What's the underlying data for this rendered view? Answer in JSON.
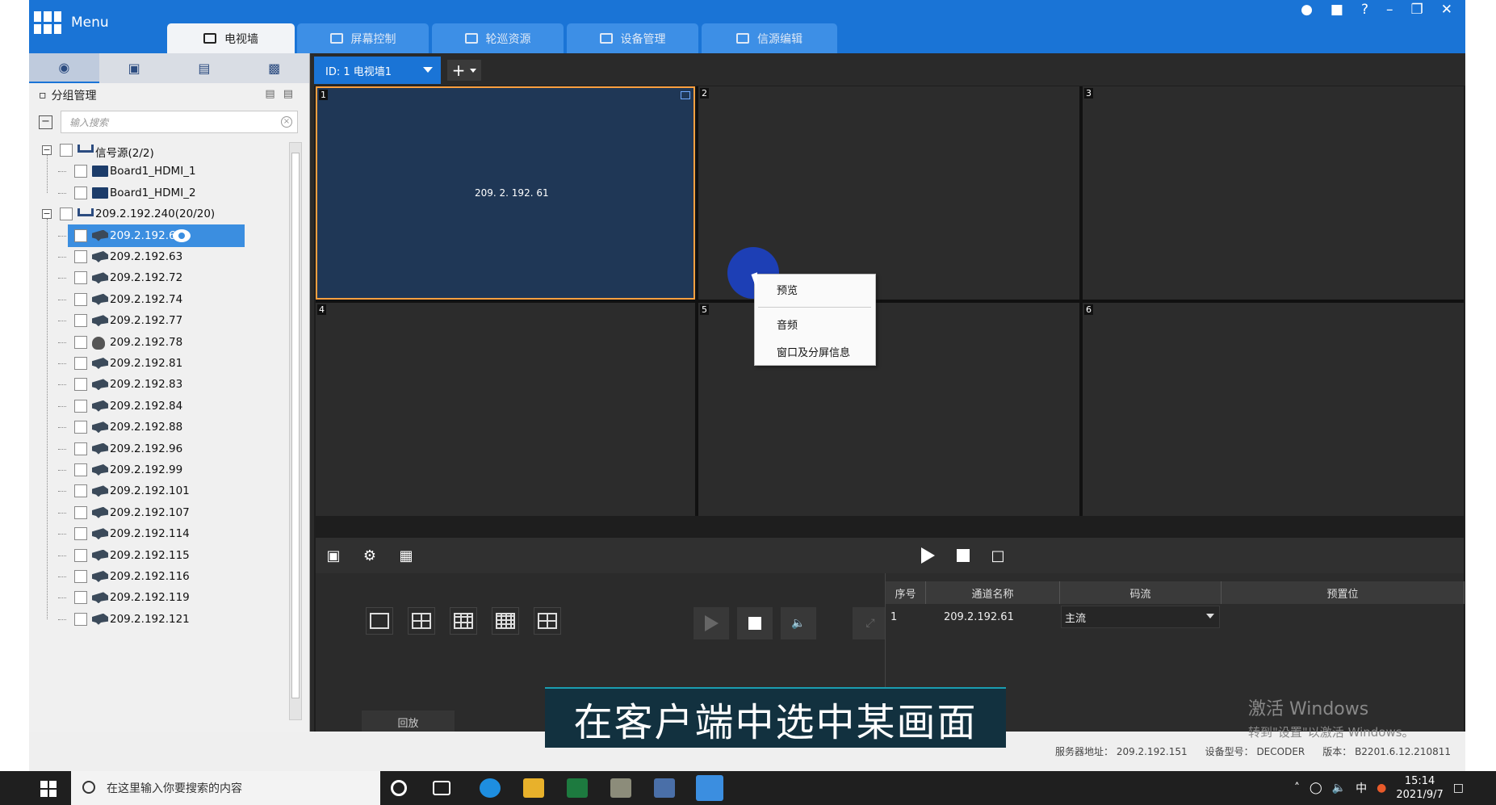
{
  "app": {
    "menu_label": "Menu",
    "tabs": [
      {
        "label": "电视墙",
        "active": true
      },
      {
        "label": "屏幕控制",
        "active": false
      },
      {
        "label": "轮巡资源",
        "active": false
      },
      {
        "label": "设备管理",
        "active": false
      },
      {
        "label": "信源编辑",
        "active": false
      }
    ],
    "window_controls": [
      "user-icon",
      "lock-icon",
      "help-icon",
      "minimize-icon",
      "restore-icon",
      "close-icon"
    ]
  },
  "left_panel": {
    "group_title": "分组管理",
    "search_placeholder": "输入搜索",
    "tree": [
      {
        "label": "信号源(2/2)",
        "type": "group",
        "level": 0
      },
      {
        "label": "Board1_HDMI_1",
        "type": "hdmi",
        "level": 1
      },
      {
        "label": "Board1_HDMI_2",
        "type": "hdmi",
        "level": 1
      },
      {
        "label": "209.2.192.240(20/20)",
        "type": "group",
        "level": 0
      },
      {
        "label": "209.2.192.61",
        "type": "cam",
        "level": 1,
        "selected": true
      },
      {
        "label": "209.2.192.63",
        "type": "cam",
        "level": 1
      },
      {
        "label": "209.2.192.72",
        "type": "cam",
        "level": 1
      },
      {
        "label": "209.2.192.74",
        "type": "cam",
        "level": 1
      },
      {
        "label": "209.2.192.77",
        "type": "cam",
        "level": 1
      },
      {
        "label": "209.2.192.78",
        "type": "dome",
        "level": 1
      },
      {
        "label": "209.2.192.81",
        "type": "cam",
        "level": 1
      },
      {
        "label": "209.2.192.83",
        "type": "cam",
        "level": 1
      },
      {
        "label": "209.2.192.84",
        "type": "cam",
        "level": 1
      },
      {
        "label": "209.2.192.88",
        "type": "cam",
        "level": 1
      },
      {
        "label": "209.2.192.96",
        "type": "cam",
        "level": 1
      },
      {
        "label": "209.2.192.99",
        "type": "cam",
        "level": 1
      },
      {
        "label": "209.2.192.101",
        "type": "cam",
        "level": 1
      },
      {
        "label": "209.2.192.107",
        "type": "cam",
        "level": 1
      },
      {
        "label": "209.2.192.114",
        "type": "cam",
        "level": 1
      },
      {
        "label": "209.2.192.115",
        "type": "cam",
        "level": 1
      },
      {
        "label": "209.2.192.116",
        "type": "cam",
        "level": 1
      },
      {
        "label": "209.2.192.119",
        "type": "cam",
        "level": 1
      },
      {
        "label": "209.2.192.121",
        "type": "cam",
        "level": 1
      }
    ]
  },
  "main": {
    "wall_tab": "ID: 1 电视墙1",
    "cells": [
      {
        "num": "1",
        "ip": "209. 2. 192. 61"
      },
      {
        "num": "2",
        "ip": ""
      },
      {
        "num": "3",
        "ip": ""
      },
      {
        "num": "4",
        "ip": ""
      },
      {
        "num": "5",
        "ip": ""
      },
      {
        "num": "6",
        "ip": ""
      }
    ],
    "context_menu": [
      "预览",
      "音频",
      "窗口及分屏信息"
    ],
    "playback_label": "回放",
    "table": {
      "headers": [
        "序号",
        "通道名称",
        "码流",
        "预置位"
      ],
      "rows": [
        {
          "index": "1",
          "channel": "209.2.192.61",
          "stream": "主流",
          "preset": ""
        }
      ]
    }
  },
  "status": {
    "server": "服务器地址： 209.2.192.151",
    "device_model": "设备型号： DECODER",
    "version": "版本： B2201.6.12.210811"
  },
  "subtitle": "在客户端中选中某画面",
  "watermark": {
    "line1": "激活 Windows",
    "line2": "转到\"设置\"以激活 Windows。"
  },
  "taskbar": {
    "search_placeholder": "在这里输入你要搜索的内容",
    "time": "15:14",
    "date": "2021/9/7",
    "ime": "中"
  },
  "colors": {
    "accent": "#1a74d6",
    "active_cell_border": "#ffa040",
    "subtitle_bg": "#12313f"
  }
}
